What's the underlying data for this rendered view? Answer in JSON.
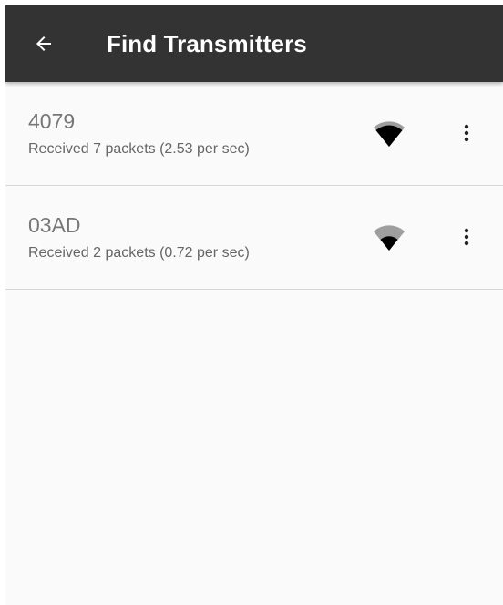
{
  "toolbar": {
    "back_icon": "arrow-left-icon",
    "title": "Find Transmitters"
  },
  "colors": {
    "toolbar_bg": "#333333",
    "list_bg": "#fafafa",
    "signal_strong": "#000000",
    "signal_weak": "#9e9e9e"
  },
  "transmitters": [
    {
      "id": "4079",
      "status": "Received 7 packets (2.53 per sec)",
      "signal_icon": "wifi-signal-icon",
      "signal_level": 3,
      "menu_icon": "more-vert-icon"
    },
    {
      "id": "03AD",
      "status": "Received 2 packets (0.72 per sec)",
      "signal_icon": "wifi-signal-icon",
      "signal_level": 2,
      "menu_icon": "more-vert-icon"
    }
  ]
}
